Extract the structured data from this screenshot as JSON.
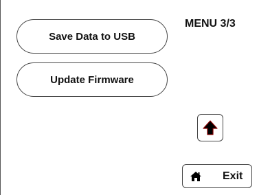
{
  "menu": {
    "title": "MENU 3/3"
  },
  "buttons": {
    "save_data_label": "Save Data to USB",
    "update_firmware_label": "Update Firmware",
    "exit_label": "Exit"
  },
  "icons": {
    "up": "arrow-up-icon",
    "home": "home-icon"
  },
  "colors": {
    "arrow": "#000000",
    "arrow_outline": "#8b0000"
  }
}
